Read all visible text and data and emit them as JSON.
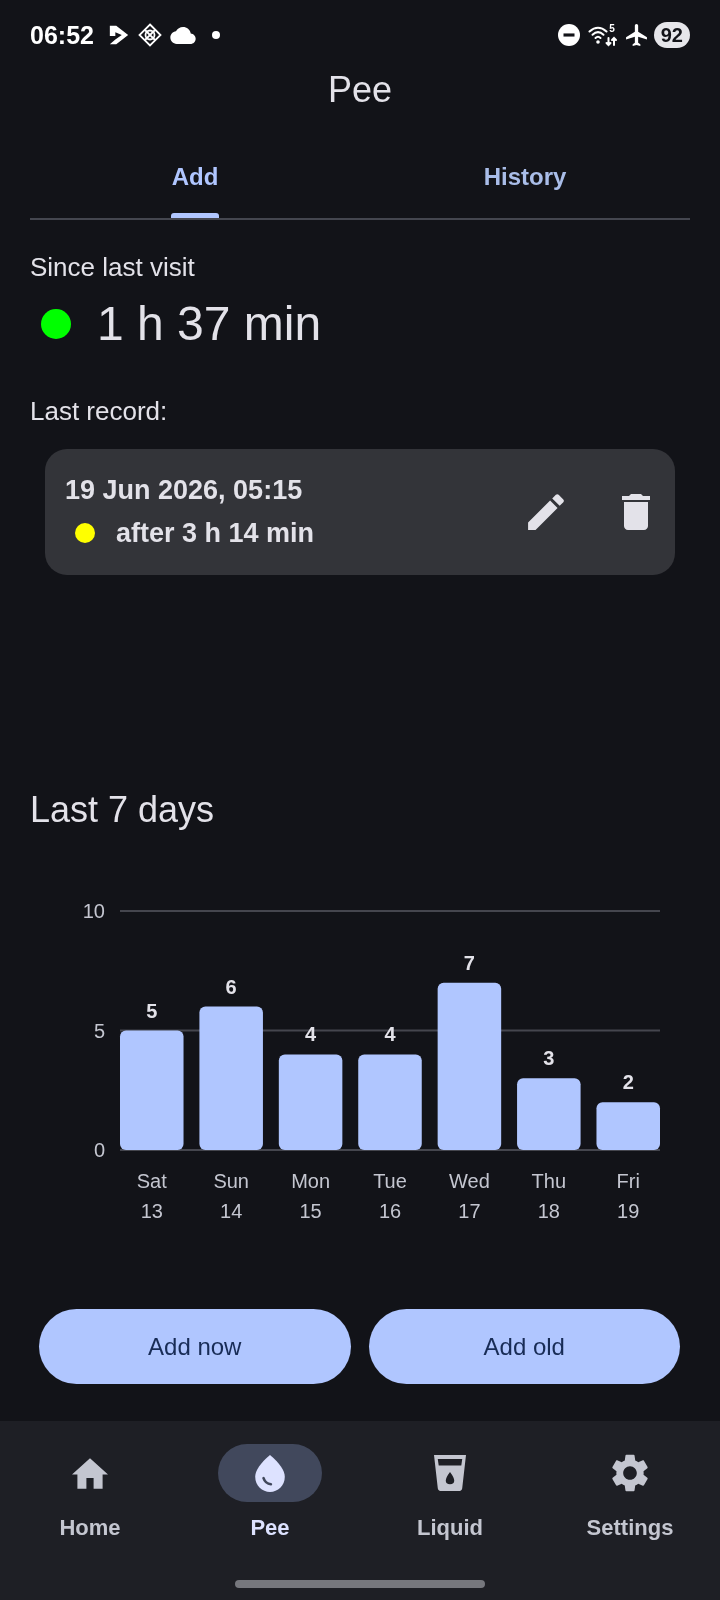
{
  "status_bar": {
    "time": "06:52",
    "wifi_badge": "5",
    "battery": "92"
  },
  "title": "Pee",
  "tabs": [
    {
      "label": "Add",
      "selected": true
    },
    {
      "label": "History",
      "selected": false
    }
  ],
  "since_last_visit": {
    "label": "Since last visit",
    "value": "1 h 37 min",
    "color": "#00ff00"
  },
  "last_record": {
    "label": "Last record:",
    "date": "19 Jun 2026, 05:15",
    "interval": "after 3 h 14 min",
    "color": "#ffff00"
  },
  "chart_section": {
    "heading": "Last 7 days",
    "chart_data": {
      "type": "bar",
      "categories": [
        "Sat\n13",
        "Sun\n14",
        "Mon\n15",
        "Tue\n16",
        "Wed\n17",
        "Thu\n18",
        "Fri\n19"
      ],
      "values": [
        5,
        6,
        4,
        4,
        7,
        3,
        2
      ],
      "ylim": [
        0,
        10
      ],
      "yticks": [
        0,
        5,
        10
      ],
      "data_labels": true
    }
  },
  "buttons": [
    {
      "label": "Add now"
    },
    {
      "label": "Add old"
    }
  ],
  "bottom_nav": [
    {
      "label": "Home",
      "selected": false
    },
    {
      "label": "Pee",
      "selected": true
    },
    {
      "label": "Liquid",
      "selected": false
    },
    {
      "label": "Settings",
      "selected": false
    }
  ]
}
